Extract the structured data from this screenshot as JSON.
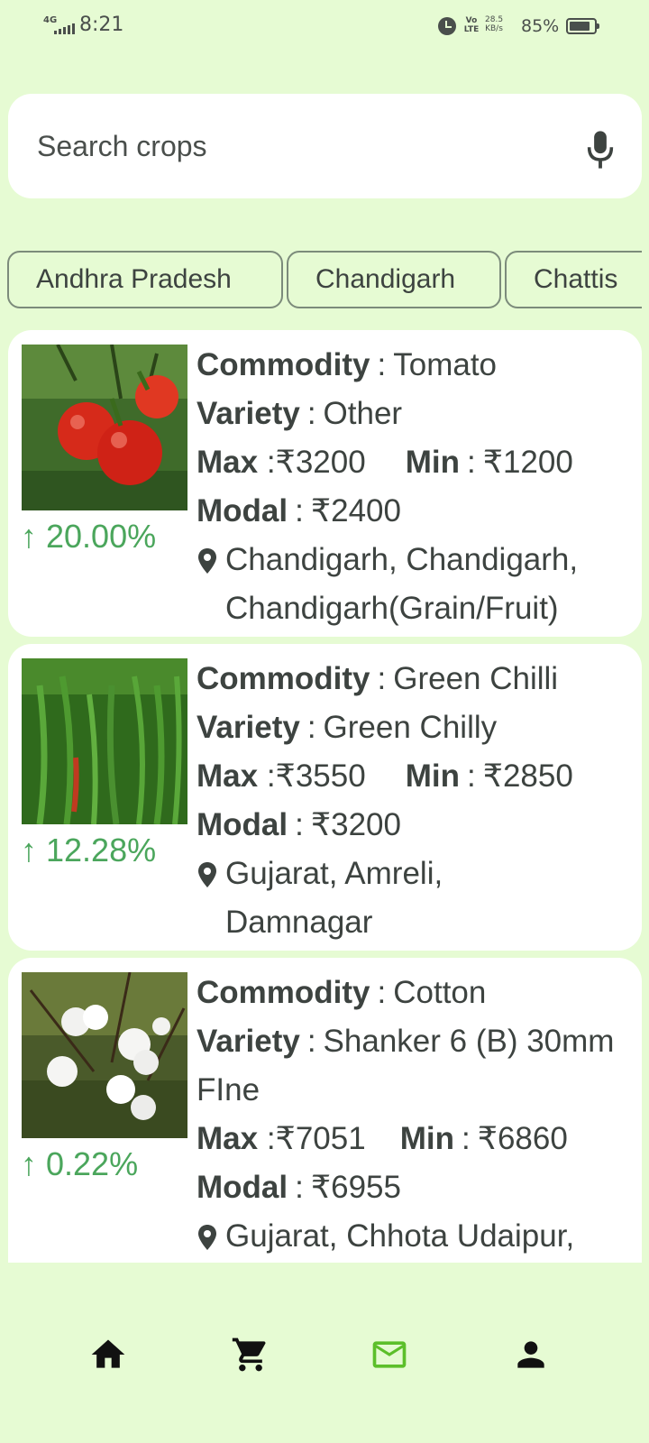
{
  "status_bar": {
    "network": "4G",
    "time": "8:21",
    "volte": "Vo)) LTE",
    "speed_value": "28.5",
    "speed_unit": "KB/s",
    "battery_percent": "85%",
    "battery_level": 0.85
  },
  "search": {
    "placeholder": "Search crops",
    "icon": "mic-icon"
  },
  "state_chips": [
    "Andhra Pradesh",
    "Chandigarh",
    "Chattis"
  ],
  "labels": {
    "commodity": "Commodity",
    "variety": "Variety",
    "max": "Max",
    "min": "Min",
    "modal": "Modal"
  },
  "crops": [
    {
      "commodity": "Tomato",
      "variety": "Other",
      "max": "₹3200",
      "min": "₹1200",
      "modal": "₹2400",
      "change": "↑ 20.00%",
      "location": "Chandigarh, Chandigarh, Chandigarh(Grain/Fruit)"
    },
    {
      "commodity": "Green Chilli",
      "variety": "Green Chilly",
      "max": "₹3550",
      "min": "₹2850",
      "modal": "₹3200",
      "change": "↑ 12.28%",
      "location": "Gujarat, Amreli, Damnagar"
    },
    {
      "commodity": "Cotton",
      "variety": "Shanker 6 (B) 30mm FIne",
      "max": "₹7051",
      "min": "₹6860",
      "modal": "₹6955",
      "change": "↑ 0.22%",
      "location": "Gujarat, Chhota Udaipur,"
    }
  ],
  "bottom_nav": [
    {
      "icon": "home-icon",
      "active": false
    },
    {
      "icon": "cart-icon",
      "active": false
    },
    {
      "icon": "mail-icon",
      "active": true
    },
    {
      "icon": "person-icon",
      "active": false
    }
  ],
  "colors": {
    "background": "#e6fbd3",
    "positive": "#4ba65c",
    "active_nav": "#5cbf2a",
    "text": "#3d4340"
  }
}
